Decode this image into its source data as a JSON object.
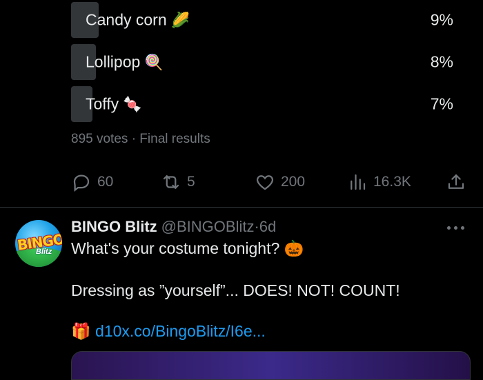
{
  "poll": {
    "options": [
      {
        "label": "Candy corn",
        "emoji": "🌽",
        "percent_text": "9%",
        "percent": 9
      },
      {
        "label": "Lollipop",
        "emoji": "🍭",
        "percent_text": "8%",
        "percent": 8
      },
      {
        "label": "Toffy",
        "emoji": "🍬",
        "percent_text": "7%",
        "percent": 7
      }
    ],
    "votes_text": "895 votes",
    "separator": "·",
    "status_text": "Final results"
  },
  "actions": {
    "replies": "60",
    "reposts": "5",
    "likes": "200",
    "views": "16.3K"
  },
  "tweet": {
    "display_name": "BINGO Blitz",
    "handle": "@BINGOBlitz",
    "separator": "·",
    "age": "6d",
    "avatar_logo_top": "BINGO",
    "avatar_logo_bottom": "Blitz",
    "line1_text": "What's your costume tonight?",
    "line1_emoji": "🎃",
    "line2_text": "Dressing as ”yourself”... DOES! NOT! COUNT!",
    "link_emoji": "🎁",
    "link_text": "d10x.co/BingoBlitz/I6e..."
  },
  "colors": {
    "background": "#000000",
    "text": "#e7e9ea",
    "muted": "#71767b",
    "link": "#1d9bf0",
    "poll_bar": "#333639"
  }
}
